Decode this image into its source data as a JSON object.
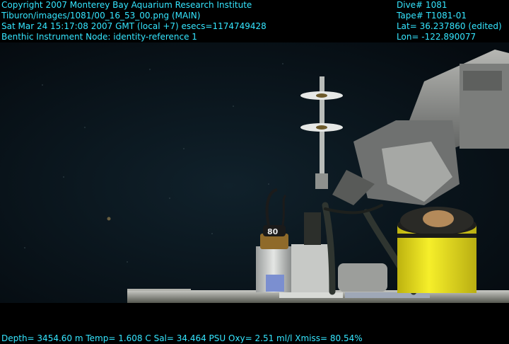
{
  "overlay": {
    "color": "#35e6ff",
    "top_left": {
      "copyright": "Copyright 2007 Monterey Bay Aquarium Research Institute",
      "image_path": "Tiburon/images/1081/00_16_53_00.png (MAIN)",
      "datetime": "Sat Mar 24 15:17:08 2007 GMT (local +7)  esecs=1174749428",
      "node": "Benthic Instrument Node: identity-reference 1"
    },
    "top_right": {
      "dive": "Dive# 1081",
      "tape": "Tape# T1081-01",
      "lat": "Lat= 36.237860 (edited)",
      "lon": "Lon= -122.890077"
    },
    "bottom": {
      "telemetry": "Depth= 3454.60 m  Temp= 1.608 C  Sal= 34.464 PSU  Oxy= 2.51 ml/l  Xmiss= 80.54%"
    }
  },
  "scene": {
    "water_color": "#0b1820",
    "instrument_label": "80",
    "colors": {
      "yellow_canister": "#f2ea1a",
      "arm_gray": "#8d8f8e",
      "frame_gray": "#8a8b86"
    }
  }
}
